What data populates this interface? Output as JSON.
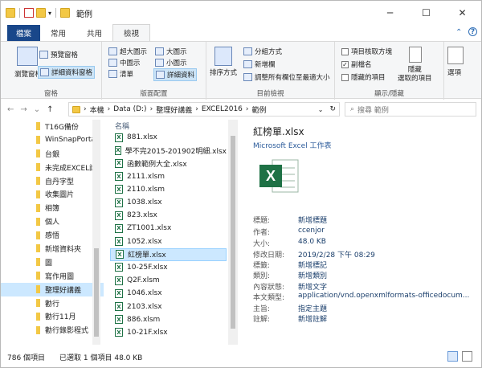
{
  "title": "範例",
  "window_controls": {
    "minimize": "─",
    "maximize": "☐",
    "close": "✕"
  },
  "tabs": [
    "檔案",
    "常用",
    "共用",
    "檢視"
  ],
  "ribbon_right": {
    "collapse": "⌃",
    "help": "?"
  },
  "ribbon": {
    "panes": {
      "nav_pane": "瀏覽窗格",
      "preview_pane": "預覽窗格",
      "details_pane": "詳細資料窗格",
      "label": "窗格"
    },
    "layout": {
      "items": [
        "超大圖示",
        "大圖示",
        "中圖示",
        "小圖示",
        "清單",
        "詳細資料"
      ],
      "label": "版面配置"
    },
    "current_view": {
      "sort": "排序方式",
      "group_by": "分組方式",
      "add_column": "新增欄",
      "fit_columns": "調整所有欄位至最適大小",
      "label": "目前檢視"
    },
    "show_hide": {
      "item_checkbox": "項目核取方塊",
      "extensions": "副檔名",
      "hidden_items": "隱藏的項目",
      "hide_selected": "隱藏\n選取的項目",
      "options": "選項",
      "label": "顯示/隱藏"
    }
  },
  "nav": {
    "back": "←",
    "forward": "→",
    "recent": "⌄",
    "up": "↑"
  },
  "address": [
    "本機",
    "Data (D:)",
    "整理好講義",
    "EXCEL2016",
    "範例"
  ],
  "search_placeholder": "搜尋 範例",
  "nav_pane_items": [
    "T16G備份",
    "WinSnapPorta",
    "台銀",
    "未完成EXCEL講",
    "自丹字型",
    "收集圖片",
    "相簿",
    "個人",
    "感悟",
    "新增資料夾",
    "圖",
    "寫作用圖",
    "整理好講義",
    "勸行",
    "勸行11月",
    "勸行錄影程式"
  ],
  "file_header": "名稱",
  "files": [
    "881.xlsx",
    "學不完2015-201902明細.xlsx",
    "函數範例大全.xlsx",
    "2111.xlsm",
    "2110.xlsm",
    "1038.xlsx",
    "823.xlsx",
    "ZT1001.xlsx",
    "1052.xlsx",
    "紅榜單.xlsx",
    "10-25F.xlsx",
    "Q2F.xlsm",
    "1046.xlsx",
    "2103.xlsx",
    "886.xlsm",
    "10-21F.xlsx"
  ],
  "details": {
    "name": "紅榜單.xlsx",
    "type": "Microsoft Excel 工作表",
    "rows": [
      {
        "k": "標題:",
        "v": "新增標題"
      },
      {
        "k": "作者:",
        "v": "ccenjor"
      },
      {
        "k": "大小:",
        "v": "48.0 KB"
      },
      {
        "k": "修改日期:",
        "v": "2019/2/28 下午 08:29"
      },
      {
        "k": "標籤:",
        "v": "新增標記"
      },
      {
        "k": "類別:",
        "v": "新增類別"
      },
      {
        "k": "內容狀態:",
        "v": "新增文字"
      },
      {
        "k": "本文類型:",
        "v": "application/vnd.openxmlformats-officedocum..."
      },
      {
        "k": "主旨:",
        "v": "指定主題"
      },
      {
        "k": "註解:",
        "v": "新增註解"
      }
    ]
  },
  "status": {
    "count": "786 個項目",
    "selected": "已選取 1 個項目 48.0 KB"
  }
}
